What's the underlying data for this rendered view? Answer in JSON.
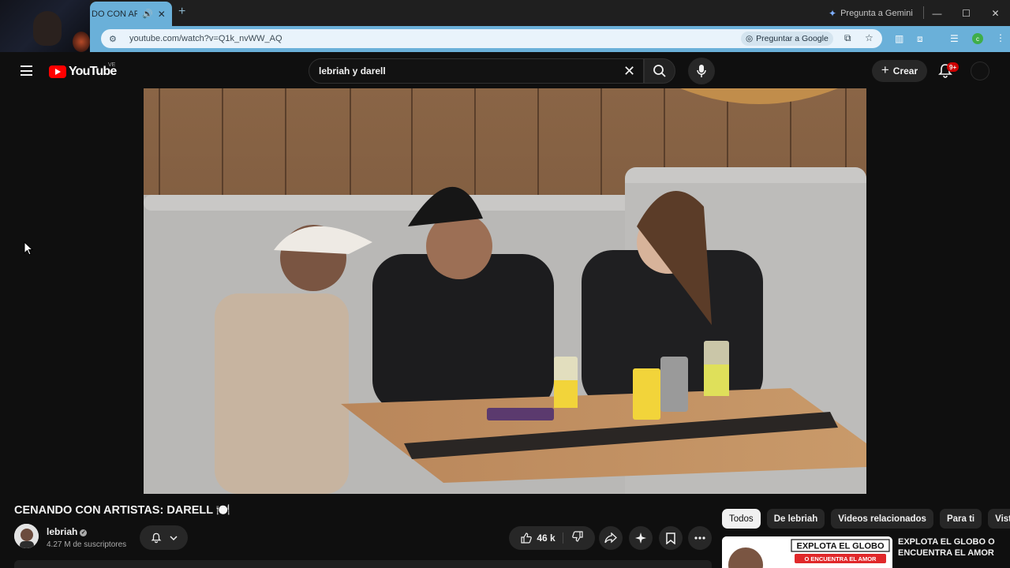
{
  "browser": {
    "tab_title": "DO CON ARTI",
    "new_tab": "+",
    "gemini_label": "Pregunta a Gemini",
    "url": "youtube.com/watch?v=Q1k_nvWW_AQ",
    "ask_google_label": "Preguntar a Google",
    "profile_initial": "c",
    "window_controls": [
      "—",
      "☐",
      "✕"
    ]
  },
  "header": {
    "logo_text": "YouTube",
    "country": "VE",
    "search_query": "lebriah y darell",
    "create_label": "Crear",
    "notification_count": "9+"
  },
  "video": {
    "title": "CENANDO CON ARTISTAS: DARELL 🍽️"
  },
  "channel": {
    "name": "lebriah",
    "subscribers": "4.27 M de suscriptores"
  },
  "actions": {
    "likes": "46 k"
  },
  "sidebar": {
    "chips": [
      "Todos",
      "De lebriah",
      "Videos relacionados",
      "Para ti",
      "Visto"
    ],
    "recommendation": {
      "thumb_text_1": "EXPLOTA EL GLOBO",
      "thumb_text_2": "O ENCUENTRA EL AMOR",
      "title": "EXPLOTA EL GLOBO O ENCUENTRA EL AMOR"
    }
  },
  "colors": {
    "youtube_red": "#ff0000",
    "background": "#0f0f0f",
    "browser_accent": "#6ab0d9"
  }
}
